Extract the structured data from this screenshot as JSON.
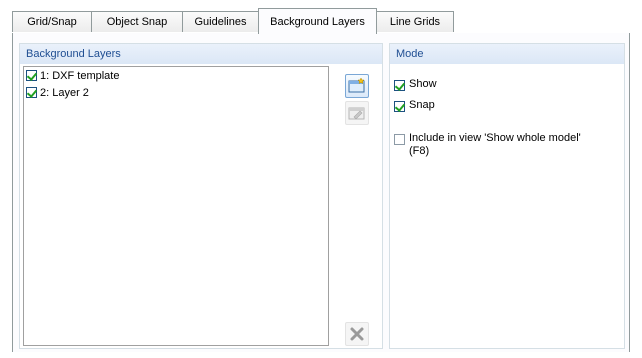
{
  "tabs": [
    {
      "label": "Grid/Snap",
      "active": false
    },
    {
      "label": "Object Snap",
      "active": false
    },
    {
      "label": "Guidelines",
      "active": false
    },
    {
      "label": "Background Layers",
      "active": true
    },
    {
      "label": "Line Grids",
      "active": false
    }
  ],
  "background_layers": {
    "header": "Background Layers",
    "items": [
      {
        "label": "1: DXF template",
        "checked": true
      },
      {
        "label": "2: Layer 2",
        "checked": true
      }
    ],
    "buttons": {
      "new": "new-layer-icon",
      "edit": "edit-layer-icon",
      "delete": "delete-layer-icon"
    }
  },
  "mode": {
    "header": "Mode",
    "show_label": "Show",
    "show_checked": true,
    "snap_label": "Snap",
    "snap_checked": true,
    "include_label_line1": "Include in view 'Show whole model'",
    "include_label_line2": "(F8)",
    "include_checked": false
  },
  "colors": {
    "header_text": "#1f4e92",
    "check": "#21a121",
    "border": "#919b9c"
  }
}
